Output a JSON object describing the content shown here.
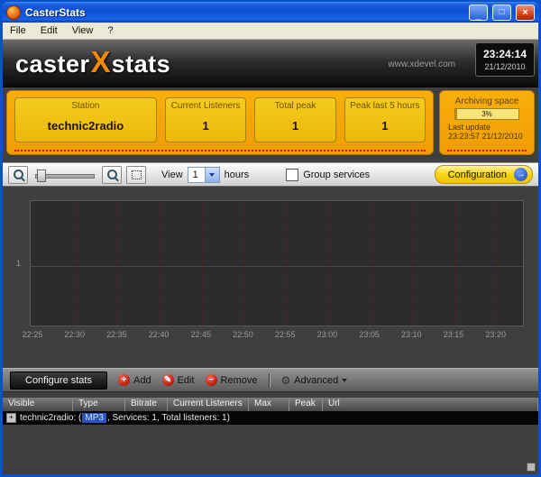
{
  "window": {
    "title": "CasterStats",
    "menu": [
      "File",
      "Edit",
      "View",
      "?"
    ]
  },
  "icons": {
    "minimize": "_",
    "maximize": "□",
    "close": "×",
    "add": "+",
    "edit": "✎",
    "remove": "−",
    "config_arrow": "→",
    "advanced": "⚙",
    "expand": "+"
  },
  "header": {
    "logo": {
      "part1": "caster",
      "part2": "X",
      "part3": "stats"
    },
    "website": "www.xdevel.com",
    "clock": {
      "time": "23:24:14",
      "date": "21/12/2010"
    }
  },
  "stats": {
    "cards": [
      {
        "label": "Station",
        "value": "technic2radio"
      },
      {
        "label": "Current Listeners",
        "value": "1"
      },
      {
        "label": "Total peak",
        "value": "1"
      },
      {
        "label": "Peak last 5 hours",
        "value": "1"
      }
    ],
    "archiving": {
      "label": "Archiving space",
      "percent": "3%",
      "last_update_label": "Last update",
      "last_update_value": "23:23:57 21/12/2010"
    }
  },
  "toolbar": {
    "view_label": "View",
    "view_value": "1",
    "hours_label": "hours",
    "group_services_label": "Group services",
    "configuration_label": "Configuration"
  },
  "chart_data": {
    "type": "line",
    "title": "",
    "x": [
      "22:25",
      "22:30",
      "22:35",
      "22:40",
      "22:45",
      "22:50",
      "22:55",
      "23:00",
      "23:05",
      "23:10",
      "23:15",
      "23:20"
    ],
    "series": [
      {
        "name": "technic2radio",
        "values": [
          1,
          1,
          1,
          1,
          1,
          1,
          1,
          1,
          1,
          1,
          1,
          1
        ]
      }
    ],
    "y_tick": "1",
    "ylim": [
      0,
      2
    ],
    "grid": "vertical-dashed",
    "legend": "none",
    "plot_bg": "#2c2c2c",
    "gridline_color": "#5a1f1f"
  },
  "bottom_toolbar": {
    "configure": "Configure stats",
    "add": "Add",
    "edit": "Edit",
    "remove": "Remove",
    "advanced": "Advanced"
  },
  "table": {
    "columns": [
      "Visible",
      "Type",
      "Bitrate",
      "Current Listeners",
      "Max",
      "Peak",
      "Url"
    ],
    "row": {
      "prefix": "technic2radio: (",
      "highlight": "MP3",
      "suffix": ", Services: 1, Total listeners: 1)"
    }
  }
}
